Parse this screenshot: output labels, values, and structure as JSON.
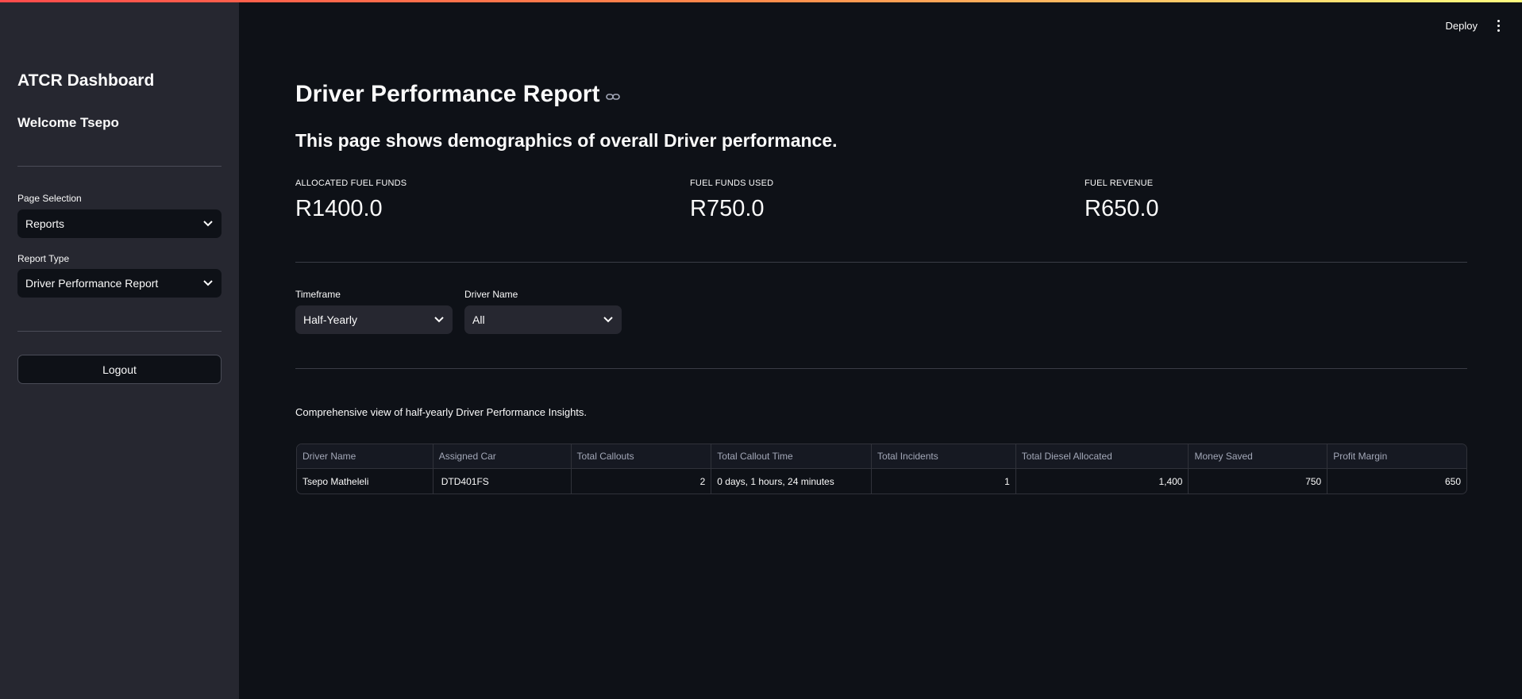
{
  "header": {
    "deploy_label": "Deploy"
  },
  "sidebar": {
    "title": "ATCR Dashboard",
    "welcome": "Welcome Tsepo",
    "page_selection_label": "Page Selection",
    "page_selection_value": "Reports",
    "report_type_label": "Report Type",
    "report_type_value": "Driver Performance Report",
    "logout_label": "Logout"
  },
  "main": {
    "title": "Driver Performance Report",
    "subtitle": "This page shows demographics of overall Driver performance.",
    "metrics": [
      {
        "label": "ALLOCATED FUEL FUNDS",
        "value": "R1400.0"
      },
      {
        "label": "FUEL FUNDS USED",
        "value": "R750.0"
      },
      {
        "label": "FUEL REVENUE",
        "value": "R650.0"
      }
    ],
    "filters": {
      "timeframe_label": "Timeframe",
      "timeframe_value": "Half-Yearly",
      "driver_label": "Driver Name",
      "driver_value": "All"
    },
    "caption": "Comprehensive view of half-yearly Driver Performance Insights.",
    "table": {
      "columns": [
        "Driver Name",
        "Assigned Car",
        "Total Callouts",
        "Total Callout Time",
        "Total Incidents",
        "Total Diesel Allocated",
        "Money Saved",
        "Profit Margin"
      ],
      "rows": [
        [
          "Tsepo Matheleli",
          "DTD401FS",
          "2",
          "0 days, 1 hours, 24 minutes",
          "1",
          "1,400",
          "750",
          "650"
        ]
      ]
    }
  }
}
